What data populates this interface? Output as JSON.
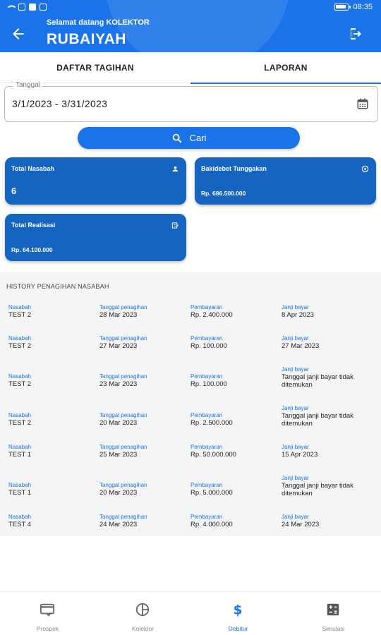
{
  "status_bar": {
    "time": "08:35"
  },
  "header": {
    "greeting": "Selamat datang KOLEKTOR",
    "username": "RUBAIYAH",
    "accent_color": "#1a73e8"
  },
  "tabs": [
    {
      "label": "DAFTAR TAGIHAN",
      "active": false
    },
    {
      "label": "LAPORAN",
      "active": true
    }
  ],
  "date_filter": {
    "label": "Tanggal",
    "value": "3/1/2023 - 3/31/2023"
  },
  "search_button": {
    "label": "Cari"
  },
  "cards": {
    "total_nasabah": {
      "title": "Total Nasabah",
      "value": "6",
      "icon": "person-icon"
    },
    "bakidebet": {
      "title": "Bakidebet Tunggakan",
      "value": "Rp. 686.500.000",
      "icon": "info-icon"
    },
    "total_realisasi": {
      "title": "Total Realisasi",
      "value": "Rp. 64.100.000",
      "icon": "edit-icon"
    }
  },
  "history": {
    "title": "HISTORY PENAGIHAN NASABAH",
    "keys": {
      "nasabah": "Nasabah",
      "tanggal": "Tanggal penagihan",
      "pembayaran": "Pembayaran",
      "janji": "Janji bayar"
    },
    "rows": [
      {
        "nasabah": "TEST 2",
        "tanggal": "28 Mar 2023",
        "pembayaran": "Rp. 2.400.000",
        "janji": "8 Apr 2023"
      },
      {
        "nasabah": "TEST 2",
        "tanggal": "27 Mar 2023",
        "pembayaran": "Rp. 100.000",
        "janji": "27 Mar 2023"
      },
      {
        "nasabah": "TEST 2",
        "tanggal": "23 Mar 2023",
        "pembayaran": "Rp. 100.000",
        "janji": "Tanggal janji bayar tidak ditemukan"
      },
      {
        "nasabah": "TEST 2",
        "tanggal": "20 Mar 2023",
        "pembayaran": "Rp. 2.500.000",
        "janji": "Tanggal janji bayar tidak ditemukan"
      },
      {
        "nasabah": "TEST 1",
        "tanggal": "25 Mar 2023",
        "pembayaran": "Rp. 50.000.000",
        "janji": "15 Apr 2023"
      },
      {
        "nasabah": "TEST 1",
        "tanggal": "20 Mar 2023",
        "pembayaran": "Rp. 5.000.000",
        "janji": "Tanggal janji bayar tidak ditemukan"
      },
      {
        "nasabah": "TEST 4",
        "tanggal": "24 Mar 2023",
        "pembayaran": "Rp. 4.000.000",
        "janji": "24 Mar 2023"
      }
    ]
  },
  "bottom_nav": [
    {
      "label": "Prospek",
      "icon": "card-check-icon",
      "active": false
    },
    {
      "label": "Kolektor",
      "icon": "pie-chart-icon",
      "active": false
    },
    {
      "label": "Debitur",
      "icon": "dollar-icon",
      "active": true
    },
    {
      "label": "Simulasi",
      "icon": "calculator-icon",
      "active": false
    }
  ]
}
